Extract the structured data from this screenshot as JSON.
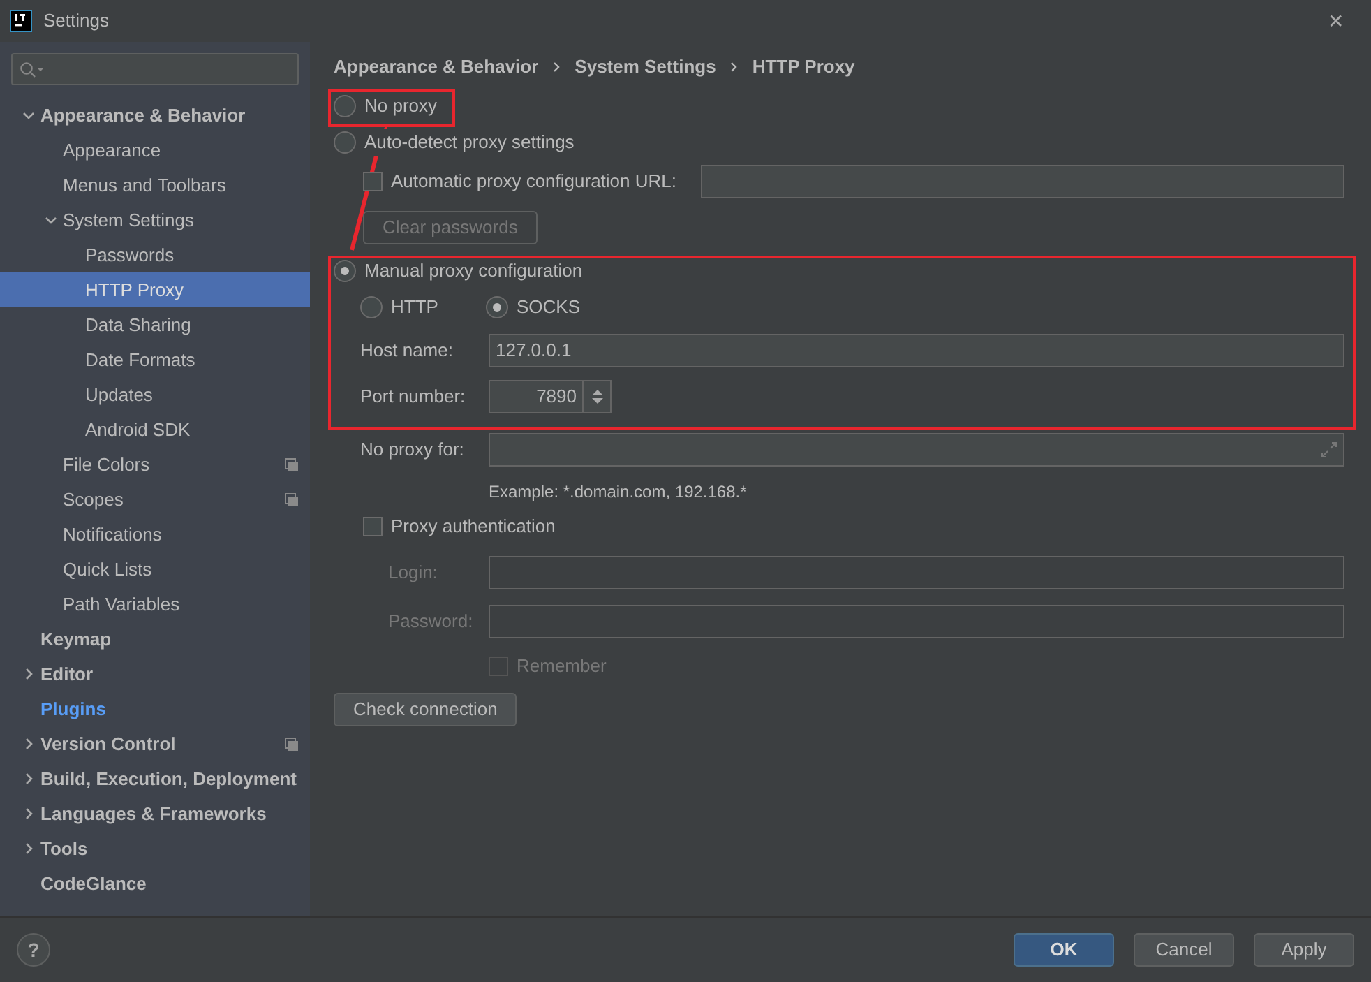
{
  "window": {
    "title": "Settings",
    "close": "✕"
  },
  "sidebar": {
    "items": [
      {
        "label": "Appearance & Behavior",
        "expanded": true,
        "selected": false,
        "children": [
          {
            "label": "Appearance",
            "selected": false
          },
          {
            "label": "Menus and Toolbars",
            "selected": false
          },
          {
            "label": "System Settings",
            "expanded": true,
            "selected": false,
            "children": [
              {
                "label": "Passwords",
                "selected": false
              },
              {
                "label": "HTTP Proxy",
                "selected": true
              },
              {
                "label": "Data Sharing",
                "selected": false
              },
              {
                "label": "Date Formats",
                "selected": false
              },
              {
                "label": "Updates",
                "selected": false
              },
              {
                "label": "Android SDK",
                "selected": false
              }
            ]
          },
          {
            "label": "File Colors",
            "selected": false,
            "project_level": true
          },
          {
            "label": "Scopes",
            "selected": false,
            "project_level": true
          },
          {
            "label": "Notifications",
            "selected": false
          },
          {
            "label": "Quick Lists",
            "selected": false
          },
          {
            "label": "Path Variables",
            "selected": false
          }
        ]
      },
      {
        "label": "Keymap",
        "selected": false
      },
      {
        "label": "Editor",
        "expanded": false,
        "selected": false
      },
      {
        "label": "Plugins",
        "selected": false,
        "modified": true
      },
      {
        "label": "Version Control",
        "expanded": false,
        "selected": false,
        "project_level": true
      },
      {
        "label": "Build, Execution, Deployment",
        "expanded": false,
        "selected": false
      },
      {
        "label": "Languages & Frameworks",
        "expanded": false,
        "selected": false
      },
      {
        "label": "Tools",
        "expanded": false,
        "selected": false
      },
      {
        "label": "CodeGlance",
        "selected": false
      }
    ]
  },
  "breadcrumb": [
    "Appearance & Behavior",
    "System Settings",
    "HTTP Proxy"
  ],
  "proxy_modes": [
    {
      "label": "No proxy",
      "selected": false
    },
    {
      "label": "Auto-detect proxy settings",
      "selected": false
    },
    {
      "label": "Manual proxy configuration",
      "selected": true
    }
  ],
  "auto_config": {
    "label": "Automatic proxy configuration URL:",
    "checked": false
  },
  "clear_passwords": {
    "label": "Clear passwords",
    "disabled": true
  },
  "protocols": [
    {
      "label": "HTTP",
      "selected": false
    },
    {
      "label": "SOCKS",
      "selected": true
    }
  ],
  "host": {
    "label": "Host name:",
    "value": "127.0.0.1"
  },
  "port": {
    "label": "Port number:",
    "value": "7890"
  },
  "no_proxy_for": {
    "label": "No proxy for:",
    "hint": "Example: *.domain.com, 192.168.*"
  },
  "proxy_auth": {
    "label": "Proxy authentication",
    "checked": false
  },
  "login": {
    "label": "Login:",
    "disabled": true
  },
  "password": {
    "label": "Password:",
    "disabled": true
  },
  "remember": {
    "label": "Remember",
    "checked": false,
    "disabled": true
  },
  "check_connection": "Check connection",
  "footer": {
    "help": "?",
    "buttons": [
      {
        "label": "OK",
        "primary": true
      },
      {
        "label": "Cancel",
        "primary": false
      },
      {
        "label": "Apply",
        "primary": false
      }
    ]
  },
  "annotations": [
    {
      "kind": "box"
    },
    {
      "kind": "box"
    },
    {
      "kind": "arrow"
    }
  ]
}
